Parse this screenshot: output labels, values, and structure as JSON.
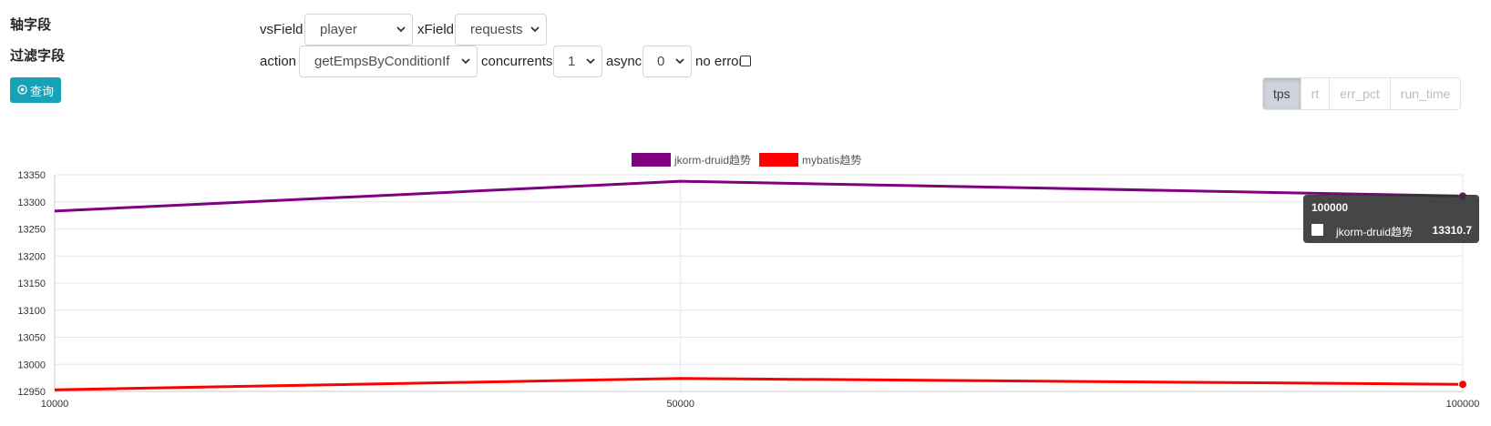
{
  "labels": {
    "axis_fields": "轴字段",
    "filter_fields": "过滤字段",
    "query_button": "查询"
  },
  "fields": {
    "vsField": {
      "label": "vsField",
      "value": "player"
    },
    "xField": {
      "label": "xField",
      "value": "requests"
    },
    "action": {
      "label": "action",
      "value": "getEmpsByConditionIf"
    },
    "concurrents": {
      "label": "concurrents",
      "value": "1"
    },
    "async": {
      "label": "async",
      "value": "0"
    },
    "no_error": {
      "label": "no error",
      "checked": false
    }
  },
  "metric_tabs": [
    {
      "label": "tps",
      "active": true
    },
    {
      "label": "rt",
      "active": false
    },
    {
      "label": "err_pct",
      "active": false
    },
    {
      "label": "run_time",
      "active": false
    }
  ],
  "tooltip": {
    "title": "100000",
    "series_name": "jkorm-druid趋势",
    "value": "13310.7"
  },
  "chart_data": {
    "type": "line",
    "x": [
      10000,
      50000,
      100000
    ],
    "x_tick_labels": [
      "10000",
      "50000",
      "100000"
    ],
    "series": [
      {
        "name": "jkorm-druid趋势",
        "values": [
          13283,
          13338,
          13310.7
        ],
        "color": "#800080"
      },
      {
        "name": "mybatis趋势",
        "values": [
          12953,
          12974,
          12963
        ],
        "color": "#ff0000"
      }
    ],
    "ylim": [
      12950,
      13350
    ],
    "y_ticks": [
      12950,
      13000,
      13050,
      13100,
      13150,
      13200,
      13250,
      13300,
      13350
    ],
    "grid": true,
    "legend_position": "top-center"
  }
}
